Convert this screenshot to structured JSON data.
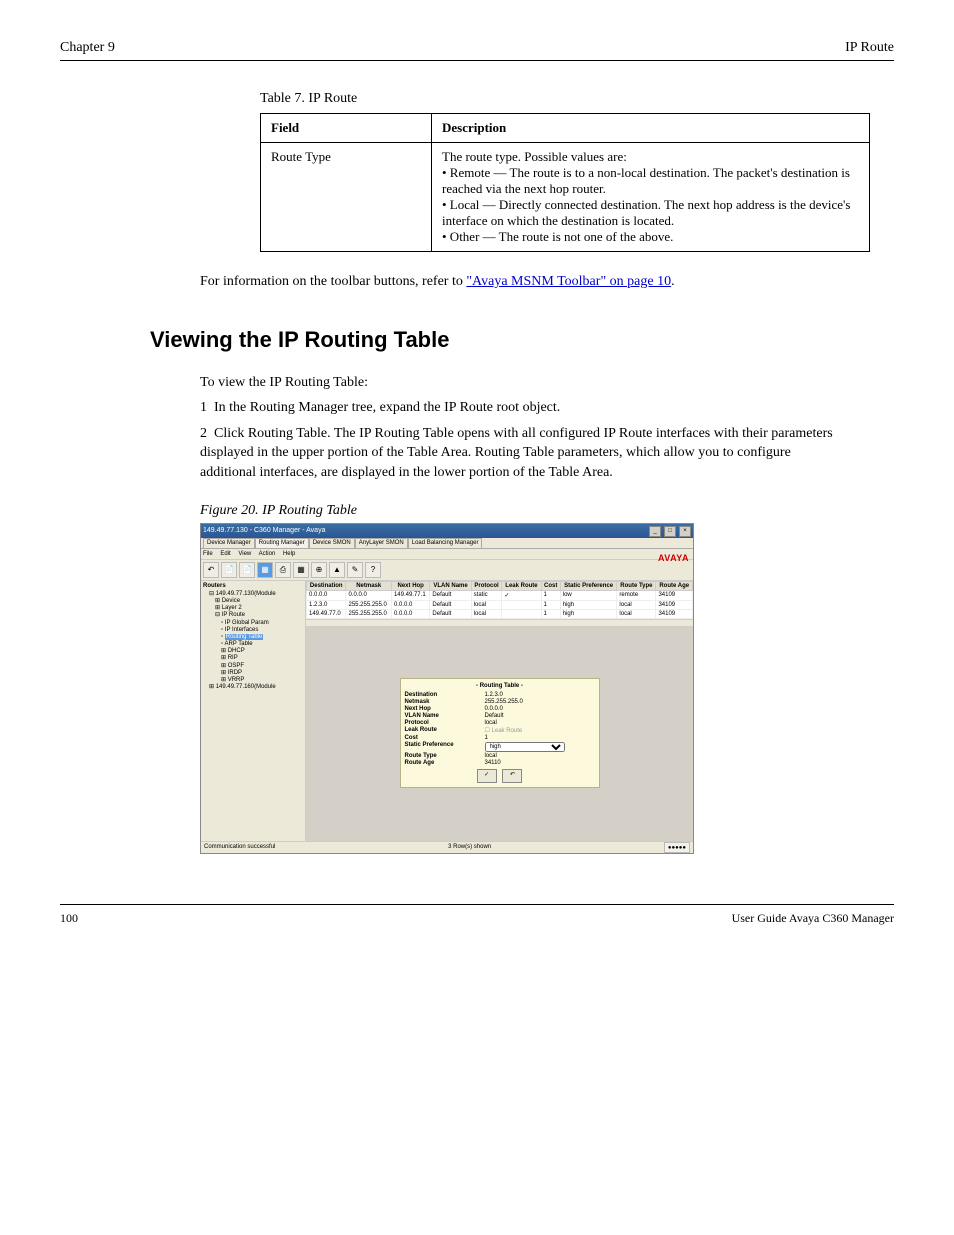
{
  "header": {
    "left": "Chapter 9",
    "right": "IP Route"
  },
  "table7": {
    "caption": "Table 7. IP Route",
    "cols": [
      "Field",
      "Description"
    ],
    "rows": [
      {
        "field": "Route Type",
        "desc_lines": [
          "The route type. Possible values are:",
          "• Remote — The route is to a non-local destination. The packet's destination is reached via the next hop router.",
          "• Local — Directly connected destination. The next hop address is the device's interface on which the destination is located.",
          "• Other — The route is not one of the above."
        ]
      }
    ]
  },
  "related": {
    "lead": "For information on the toolbar buttons, refer to ",
    "link": "\"Avaya MSNM Toolbar\" on page 10",
    "tail": "."
  },
  "section": "Viewing the IP Routing Table",
  "intro": "To view the IP Routing Table:",
  "steps": [
    "In the Routing Manager tree, expand the IP Route root object.",
    "Click Routing Table. The IP Routing Table opens with all configured IP Route interfaces with their parameters displayed in the upper portion of the Table Area. Routing Table parameters, which allow you to configure additional interfaces, are displayed in the lower portion of the Table Area."
  ],
  "figure_caption": "Figure 20. IP Routing Table",
  "screenshot": {
    "title": "149.49.77.130 - C360 Manager - Avaya",
    "logo": "AVAYA",
    "tabs": {
      "items": [
        "Device Manager",
        "Routing Manager",
        "Device SMON",
        "AnyLayer SMON",
        "Load Balancing Manager"
      ],
      "active_index": 1
    },
    "menu": [
      "File",
      "Edit",
      "View",
      "Action",
      "Help"
    ],
    "tree": {
      "header": "Routers",
      "nodes": [
        {
          "label": "149.49.77.130(Module",
          "children": [
            {
              "label": "Device"
            },
            {
              "label": "Layer 2"
            },
            {
              "label": "IP Route",
              "children": [
                {
                  "label": "IP Global Param"
                },
                {
                  "label": "IP Interfaces"
                },
                {
                  "label": "Routing Table",
                  "selected": true
                },
                {
                  "label": "ARP Table"
                },
                {
                  "label": "DHCP"
                },
                {
                  "label": "RIP"
                },
                {
                  "label": "OSPF"
                },
                {
                  "label": "IRDP"
                },
                {
                  "label": "VRRP"
                }
              ]
            }
          ]
        },
        {
          "label": "149.49.77.160(Module"
        }
      ]
    },
    "grid": {
      "cols": [
        "Destination",
        "Netmask",
        "Next Hop",
        "VLAN Name",
        "Protocol",
        "Leak Route",
        "Cost",
        "Static Preference",
        "Route Type",
        "Route Age"
      ],
      "rows": [
        [
          "0.0.0.0",
          "0.0.0.0",
          "149.49.77.1",
          "Default",
          "static",
          "✓",
          "1",
          "low",
          "remote",
          "34109"
        ],
        [
          "1.2.3.0",
          "255.255.255.0",
          "0.0.0.0",
          "Default",
          "local",
          "",
          "1",
          "high",
          "local",
          "34109"
        ],
        [
          "149.49.77.0",
          "255.255.255.0",
          "0.0.0.0",
          "Default",
          "local",
          "",
          "1",
          "high",
          "local",
          "34109"
        ]
      ]
    },
    "form": {
      "title": "- Routing Table -",
      "rows": [
        {
          "label": "Destination",
          "value": "1.2.3.0"
        },
        {
          "label": "Netmask",
          "value": "255.255.255.0"
        },
        {
          "label": "Next Hop",
          "value": "0.0.0.0"
        },
        {
          "label": "VLAN Name",
          "value": "Default"
        },
        {
          "label": "Protocol",
          "value": "local"
        },
        {
          "label": "Leak Route",
          "value": "☐ Leak Route",
          "dim": true
        },
        {
          "label": "Cost",
          "value": "1"
        },
        {
          "label": "Static Preference",
          "value": "high",
          "select": true
        },
        {
          "label": "Route Type",
          "value": "local"
        },
        {
          "label": "Route Age",
          "value": "34110"
        }
      ],
      "buttons": [
        "✓",
        "↶"
      ]
    },
    "status": {
      "left": "Communication successful",
      "center": "3 Row(s) shown",
      "tray": "●●●●●"
    }
  },
  "footer": {
    "left": "100",
    "right": "User Guide Avaya C360 Manager"
  }
}
